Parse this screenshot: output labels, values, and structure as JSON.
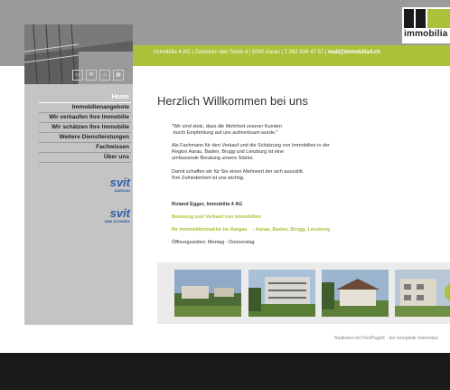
{
  "header": {
    "info": "Immobilia 4 AG | Zwischen den Toren 4 | 5000 Aarau | T 062 836 47 57 |",
    "mail": "mail@immobilia4.ch",
    "logo_text": "immobilia"
  },
  "icons": [
    "print-icon",
    "mail-icon",
    "home-icon",
    "sitemap-icon"
  ],
  "nav": {
    "items": [
      {
        "label": "Home"
      },
      {
        "label": "Immobilienangebote"
      },
      {
        "label": "Wir verkaufen Ihre Immobilie"
      },
      {
        "label": "Wir schätzen Ihre Immobilie"
      },
      {
        "label": "Weitere Dienstleistungen"
      },
      {
        "label": "Fachwissen"
      },
      {
        "label": "Über uns"
      }
    ]
  },
  "badges": [
    {
      "big": "svit",
      "small": "AARGAU"
    },
    {
      "big": "svit",
      "small": "SMK SCHWEIZ"
    }
  ],
  "main": {
    "title": "Herzlich Willkommen bei uns",
    "quote": "\"Wir sind stolz, dass die Mehrheit unserer Kunden\n durch Empfehlung auf uns aufmerksam wurde.\"",
    "para1": "Als Fachmann für den Verkauf und die Schätzung von Immobilien in der\nRegion Aarau, Baden, Brugg und Lenzburg ist eine\numfassende Beratung unsere Stärke.",
    "para2": "Damit schaffen wir für Sie einen Mehrwert der sich auszahlt.\nIhre Zufriedenheit ist uns wichtig.",
    "signature": "Roland Egger, Immobilia 4 AG",
    "tagline1": "Beratung und Verkauf von Immobilien",
    "tagline2": "Ihr Immobilienmakler im Aargau    : Aarau, Baden, Brugg, Lenzburg",
    "hours": "Öffnungszeiten: Montag - Donnerstag"
  },
  "footer": {
    "text": "Realisiert mit FlexiPage® - der komplette Internetau"
  },
  "colors": {
    "accent": "#a9c23a",
    "gray": "#9b9b9b",
    "sidebar": "#c4c4c4",
    "dark": "#1a1a1a"
  }
}
